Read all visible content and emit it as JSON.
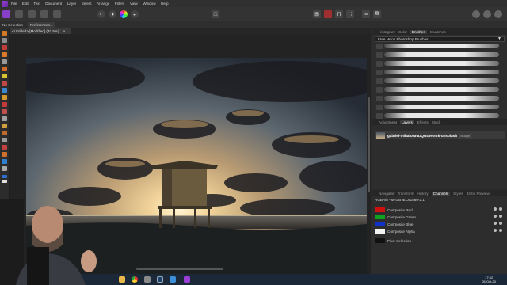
{
  "menu": {
    "items": [
      "File",
      "Edit",
      "Text",
      "Document",
      "Layer",
      "Select",
      "Arrange",
      "Filters",
      "View",
      "Window",
      "Help"
    ]
  },
  "context": {
    "selection_label": "No Selection",
    "preferences_label": "Preferences..."
  },
  "document": {
    "tab_title": "<Untitled> [Modified] (40.5%)",
    "close": "×"
  },
  "brushes_panel": {
    "tabs": [
      "Histogram",
      "Color",
      "Brushes",
      "Swatches"
    ],
    "active_tab": "Brushes",
    "category": "Free Moon Photoshop Brushes",
    "brush_count": 9
  },
  "layers_panel": {
    "tabs": [
      "Adjustment",
      "Layers",
      "Effects",
      "Stock"
    ],
    "active_tab": "Layers",
    "layer": {
      "name": "gabriel-mihalcea-IDQU4Te0r2k-unsplash",
      "type": "(Image)"
    }
  },
  "channels_panel": {
    "tabs": [
      "Navigator",
      "Transform",
      "History",
      "Channels",
      "Styles",
      "32-bit Preview"
    ],
    "active_tab": "Channels",
    "header": "RGBA/8 - sRGB IEC61966-2.1",
    "channels": [
      {
        "name": "Composite Red",
        "color": "#d01010"
      },
      {
        "name": "Composite Green",
        "color": "#0fa020"
      },
      {
        "name": "Composite Blue",
        "color": "#1030c8"
      },
      {
        "name": "Composite Alpha",
        "color": "#f2f2f2"
      }
    ],
    "pixel_selection": "Pixel Selection"
  },
  "taskbar": {
    "time": "17:52",
    "date": "05-Oct-20",
    "apps": [
      "explorer-icon",
      "chrome-icon",
      "settings-icon",
      "steam-icon",
      "photos-icon",
      "affinity-photo-icon"
    ]
  },
  "colors": {
    "accent": "#9b3fd6",
    "panel_bg": "#2d2d2d",
    "taskbar_bg": "#1b2838"
  }
}
